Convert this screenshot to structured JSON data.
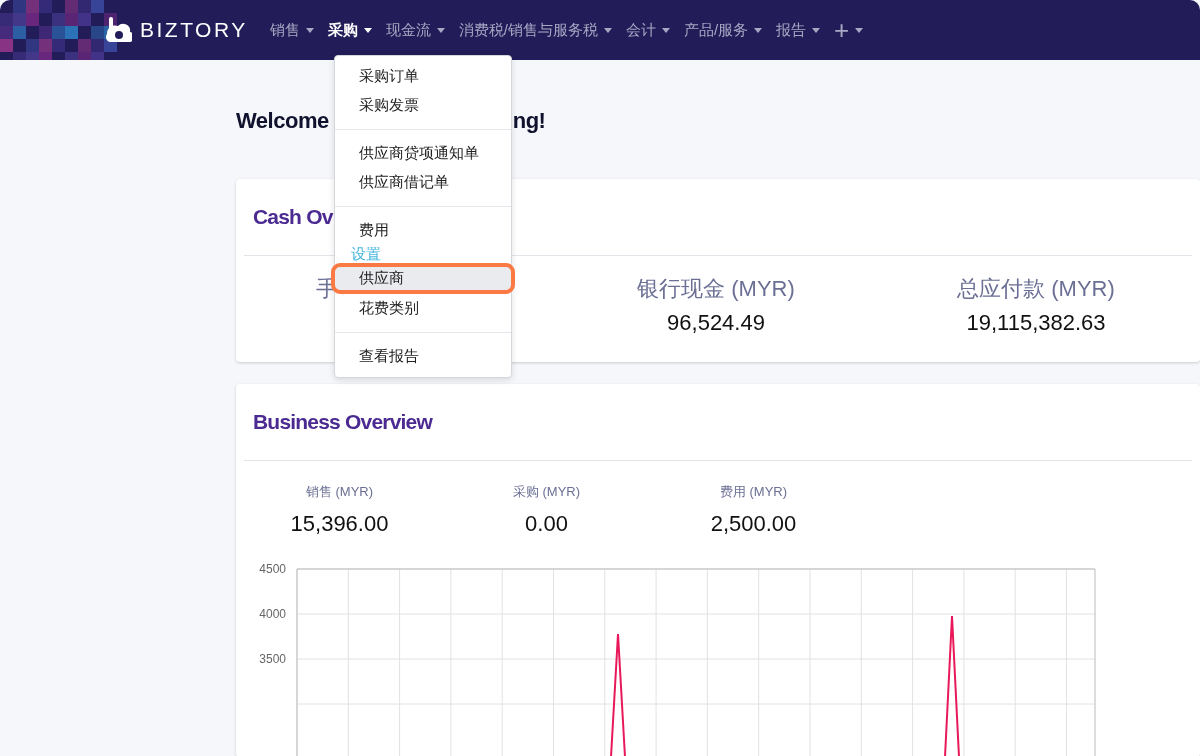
{
  "navbar": {
    "brand": "BIZTORY",
    "items": [
      {
        "label": "销售",
        "selected": false
      },
      {
        "label": "采购",
        "selected": true
      },
      {
        "label": "现金流",
        "selected": false
      },
      {
        "label": "消费税/销售与服务税",
        "selected": false
      },
      {
        "label": "会计",
        "selected": false
      },
      {
        "label": "产品/服务",
        "selected": false
      },
      {
        "label": "报告",
        "selected": false
      },
      {
        "label": "+",
        "selected": false
      }
    ]
  },
  "dropdown": [
    {
      "kind": "item",
      "label": "采购订单",
      "selected": false
    },
    {
      "kind": "item",
      "label": "采购发票",
      "selected": false
    },
    {
      "kind": "divider"
    },
    {
      "kind": "item",
      "label": "供应商贷项通知单",
      "selected": false
    },
    {
      "kind": "item",
      "label": "供应商借记单",
      "selected": false
    },
    {
      "kind": "divider"
    },
    {
      "kind": "item",
      "label": "费用",
      "selected": false
    },
    {
      "kind": "header",
      "label": "设置"
    },
    {
      "kind": "item",
      "label": "供应商",
      "selected": true
    },
    {
      "kind": "item",
      "label": "花费类别",
      "selected": false
    },
    {
      "kind": "divider"
    },
    {
      "kind": "item",
      "label": "查看报告",
      "selected": false
    }
  ],
  "welcome": {
    "start": "Welcome",
    "end": "ng!"
  },
  "cash_overview": {
    "title": "Cash Ov",
    "stats": [
      {
        "label": "手"
      },
      {
        "label": "银行现金 (MYR)",
        "value": "96,524.49"
      },
      {
        "label": "总应付款 (MYR)",
        "value": "19,115,382.63"
      }
    ]
  },
  "business_overview": {
    "title": "Business Overview",
    "stats": [
      {
        "label": "销售 (MYR)",
        "value": "15,396.00"
      },
      {
        "label": "采购 (MYR)",
        "value": "0.00"
      },
      {
        "label": "费用 (MYR)",
        "value": "2,500.00"
      }
    ],
    "chart": {
      "y_ticks": [
        "4500",
        "4000",
        "3500"
      ]
    }
  }
}
